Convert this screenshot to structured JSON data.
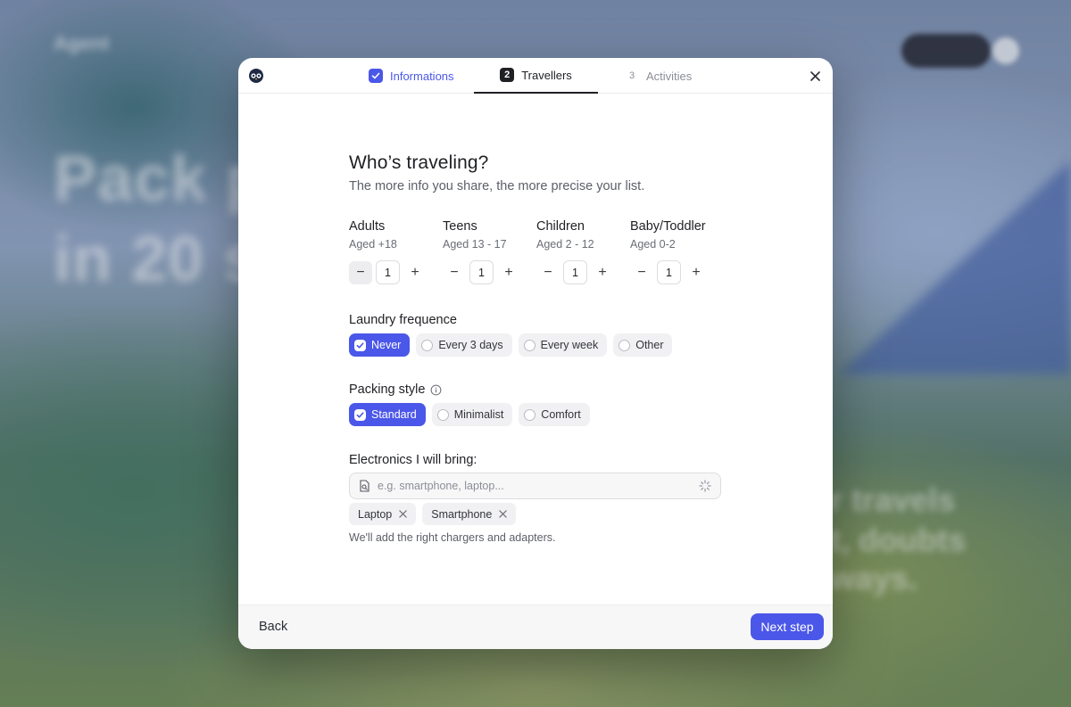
{
  "background": {
    "logo": "Agent",
    "headline_line1": "Pack p",
    "headline_line2": "in 20 s",
    "right_text_1": "r travels",
    "right_text_2": "t, doubts",
    "right_text_3": "ways."
  },
  "header": {
    "steps": [
      {
        "number": "✓",
        "label": "Informations",
        "state": "done"
      },
      {
        "number": "2",
        "label": "Travellers",
        "state": "current"
      },
      {
        "number": "3",
        "label": "Activities",
        "state": "upcoming"
      }
    ]
  },
  "content": {
    "title": "Who’s traveling?",
    "subtitle": "The more info you share, the more precise your list.",
    "travellers": [
      {
        "label": "Adults",
        "age": "Aged +18",
        "count": "1"
      },
      {
        "label": "Teens",
        "age": "Aged 13 - 17",
        "count": "1"
      },
      {
        "label": "Children",
        "age": "Aged 2 - 12",
        "count": "1"
      },
      {
        "label": "Baby/Toddler",
        "age": "Aged 0-2",
        "count": "1"
      }
    ],
    "laundry": {
      "label": "Laundry frequence",
      "options": [
        "Never",
        "Every 3 days",
        "Every week",
        "Other"
      ],
      "selected": "Never"
    },
    "packing": {
      "label": "Packing style",
      "options": [
        "Standard",
        "Minimalist",
        "Comfort"
      ],
      "selected": "Standard"
    },
    "electronics": {
      "label": "Electronics I will bring:",
      "placeholder": "e.g. smartphone, laptop...",
      "tags": [
        "Laptop",
        "Smartphone"
      ],
      "note": "We'll add the right chargers and adapters."
    }
  },
  "footer": {
    "back_label": "Back",
    "next_label": "Next step"
  },
  "colors": {
    "accent": "#4b57e8",
    "text": "#1f2024"
  }
}
